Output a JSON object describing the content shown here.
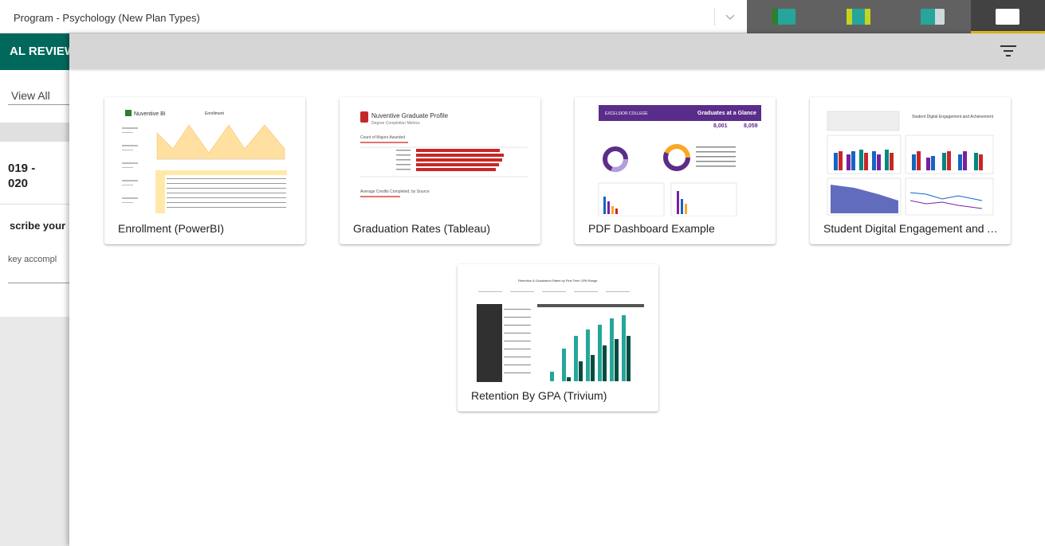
{
  "topbar": {
    "program_label": "Program - Psychology (New Plan Types)",
    "view_buttons": [
      {
        "name": "view-1",
        "color": "#26a69a"
      },
      {
        "name": "view-2",
        "color": "#26a69a"
      },
      {
        "name": "view-3",
        "color": "#cfd8dc"
      },
      {
        "name": "view-4",
        "color": "#ffffff"
      }
    ],
    "active_view": 4,
    "active_color": "#f0c419"
  },
  "leftpane": {
    "banner": "AL REVIEW",
    "view_all": "View All",
    "year_line1": "019 -",
    "year_line2": "020",
    "describe": "scribe your",
    "key": "key accompl"
  },
  "panel": {
    "filter_icon": "filter-list-icon",
    "cards": [
      {
        "title": "Enrollment (PowerBI)",
        "thumb_brand": "Nuventive BI",
        "thumb_heading": "Enrollment"
      },
      {
        "title": "Graduation Rates (Tableau)",
        "thumb_brand": "Nuventive Graduate Profile",
        "thumb_sub": "Degree Completion Metrics",
        "thumb_caption": "Count of Majors Awarded",
        "thumb_caption2": "Average Credits Completed, by Source"
      },
      {
        "title": "PDF Dashboard Example",
        "thumb_brand": "EXCELSIOR COLLEGE",
        "thumb_heading": "Graduates at a Glance",
        "thumb_stat1": "8,001",
        "thumb_stat2": "8,059"
      },
      {
        "title": "Student Digital Engagement and Achievement",
        "thumb_heading": "Student Digital Engagement and Achievement"
      },
      {
        "title": "Retention By GPA (Trivium)",
        "thumb_heading": "Retention & Graduation Rates by First Term GPA Range"
      }
    ]
  },
  "colors": {
    "accent_teal": "#00695c",
    "panel_header": "#d6d6d6",
    "switcher_bg": "#616161"
  }
}
